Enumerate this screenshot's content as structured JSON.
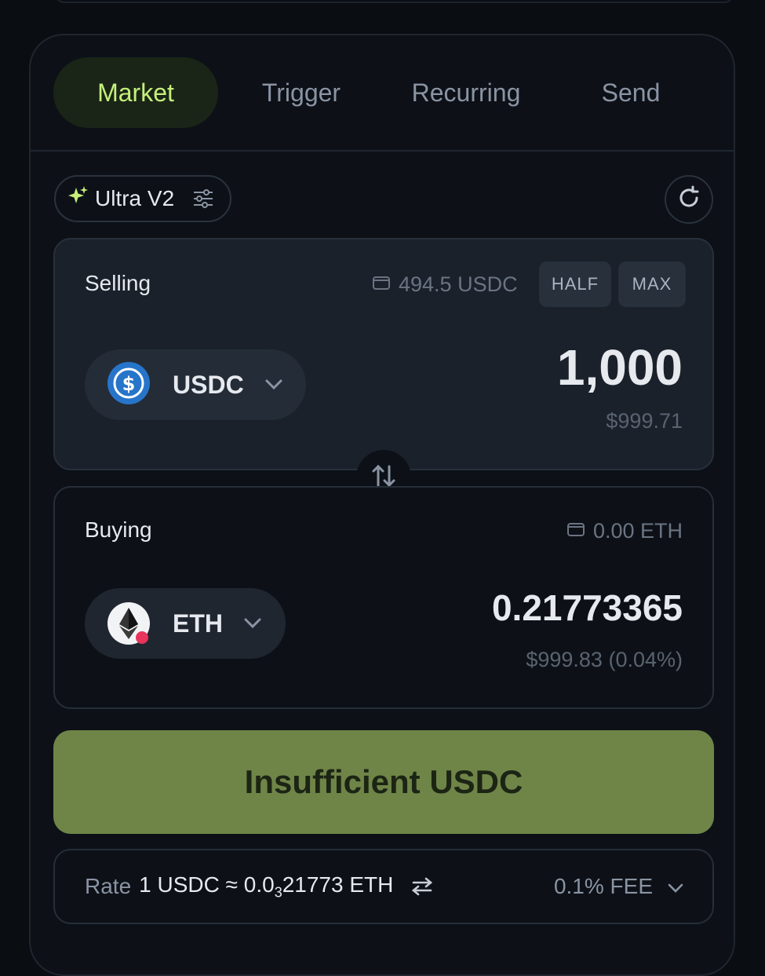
{
  "tabs": [
    {
      "label": "Market",
      "active": true
    },
    {
      "label": "Trigger",
      "active": false
    },
    {
      "label": "Recurring",
      "active": false
    },
    {
      "label": "Send",
      "active": false
    }
  ],
  "router": {
    "label": "Ultra V2",
    "icon": "sparkle-icon"
  },
  "selling": {
    "label": "Selling",
    "balance": "494.5 USDC",
    "half_label": "HALF",
    "max_label": "MAX",
    "token": "USDC",
    "amount": "1,000",
    "usd_value": "$999.71"
  },
  "buying": {
    "label": "Buying",
    "balance": "0.00 ETH",
    "token": "ETH",
    "amount": "0.21773365",
    "usd_value": "$999.83",
    "price_impact": "(0.04%)"
  },
  "cta": {
    "label": "Insufficient USDC"
  },
  "rate": {
    "label": "Rate",
    "value_prefix": "1 USDC ≈ 0.0",
    "value_subscript": "3",
    "value_suffix": "21773 ETH"
  },
  "fee": {
    "label": "0.1% FEE"
  },
  "colors": {
    "accent": "#c5f07a",
    "cta_background": "#6f8548",
    "usdc_blue": "#2775ca"
  }
}
